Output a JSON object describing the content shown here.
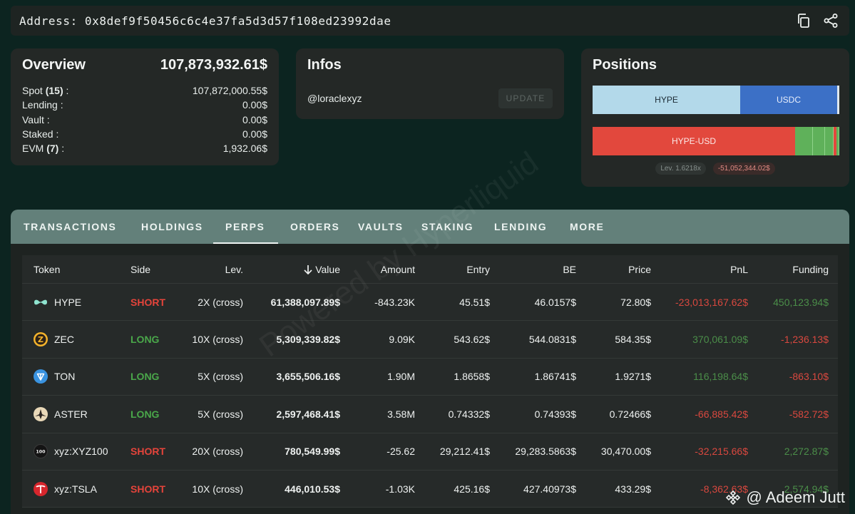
{
  "address": {
    "label": "Address:",
    "value": "0x8def9f50456c6c4e37fa5d3d57f108ed23992dae"
  },
  "icons": {
    "copy": "copy-icon",
    "share": "share-icon"
  },
  "overview": {
    "title": "Overview",
    "total": "107,873,932.61$",
    "rows": [
      {
        "label": "Spot",
        "count": "(15)",
        "suffix": ":",
        "value": "107,872,000.55$"
      },
      {
        "label": "Lending :",
        "count": "",
        "suffix": "",
        "value": "0.00$"
      },
      {
        "label": "Vault :",
        "count": "",
        "suffix": "",
        "value": "0.00$"
      },
      {
        "label": "Staked :",
        "count": "",
        "suffix": "",
        "value": "0.00$"
      },
      {
        "label": "EVM",
        "count": "(7)",
        "suffix": ":",
        "value": "1,932.06$"
      }
    ]
  },
  "infos": {
    "title": "Infos",
    "handle": "@loraclexyz",
    "update_label": "UPDATE"
  },
  "positions": {
    "title": "Positions",
    "bar1": [
      {
        "label": "HYPE",
        "share": 0.598
      },
      {
        "label": "USDC",
        "share": 0.393
      }
    ],
    "bar2_label": "HYPE-USD",
    "lev": "Lev. 1.6218x",
    "amount": "-51,052,344.02$"
  },
  "tabs": [
    "TRANSACTIONS",
    "HOLDINGS",
    "PERPS",
    "ORDERS",
    "VAULTS",
    "STAKING",
    "LENDING",
    "MORE"
  ],
  "active_tab": "PERPS",
  "table": {
    "headers": {
      "token": "Token",
      "side": "Side",
      "lev": "Lev.",
      "value": "Value",
      "amount": "Amount",
      "entry": "Entry",
      "be": "BE",
      "price": "Price",
      "pnl": "PnL",
      "funding": "Funding"
    },
    "rows": [
      {
        "token": "HYPE",
        "icon": "hype-icon",
        "side": "SHORT",
        "lev": "2X (cross)",
        "value": "61,388,097.89$",
        "amount": "-843.23K",
        "entry": "45.51$",
        "be": "46.0157$",
        "price": "72.80$",
        "pnl": "-23,013,167.62$",
        "funding": "450,123.94$"
      },
      {
        "token": "ZEC",
        "icon": "zec-icon",
        "side": "LONG",
        "lev": "10X (cross)",
        "value": "5,309,339.82$",
        "amount": "9.09K",
        "entry": "543.62$",
        "be": "544.0831$",
        "price": "584.35$",
        "pnl": "370,061.09$",
        "funding": "-1,236.13$"
      },
      {
        "token": "TON",
        "icon": "ton-icon",
        "side": "LONG",
        "lev": "5X (cross)",
        "value": "3,655,506.16$",
        "amount": "1.90M",
        "entry": "1.8658$",
        "be": "1.86741$",
        "price": "1.9271$",
        "pnl": "116,198.64$",
        "funding": "-863.10$"
      },
      {
        "token": "ASTER",
        "icon": "aster-icon",
        "side": "LONG",
        "lev": "5X (cross)",
        "value": "2,597,468.41$",
        "amount": "3.58M",
        "entry": "0.74332$",
        "be": "0.74393$",
        "price": "0.72466$",
        "pnl": "-66,885.42$",
        "funding": "-582.72$"
      },
      {
        "token": "xyz:XYZ100",
        "icon": "xyz100-icon",
        "side": "SHORT",
        "lev": "20X (cross)",
        "value": "780,549.99$",
        "amount": "-25.62",
        "entry": "29,212.41$",
        "be": "29,283.5863$",
        "price": "30,470.00$",
        "pnl": "-32,215.66$",
        "funding": "2,272.87$"
      },
      {
        "token": "xyz:TSLA",
        "icon": "tsla-icon",
        "side": "SHORT",
        "lev": "10X (cross)",
        "value": "446,010.53$",
        "amount": "-1.03K",
        "entry": "425.16$",
        "be": "427.40973$",
        "price": "433.29$",
        "pnl": "-8,362.63$",
        "funding": "2,574.94$"
      }
    ]
  },
  "watermark": "Powered by Hyperliquid",
  "credit": "@ Adeem Jutt"
}
